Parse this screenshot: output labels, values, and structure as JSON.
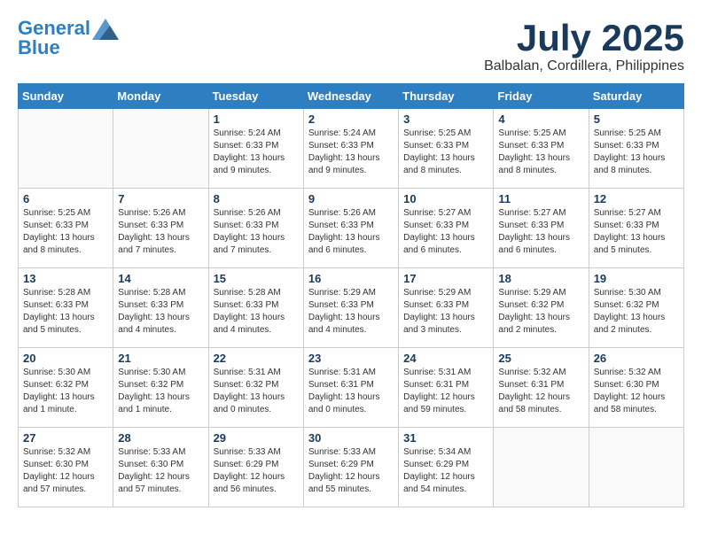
{
  "header": {
    "logo_line1": "General",
    "logo_line2": "Blue",
    "month": "July 2025",
    "location": "Balbalan, Cordillera, Philippines"
  },
  "weekdays": [
    "Sunday",
    "Monday",
    "Tuesday",
    "Wednesday",
    "Thursday",
    "Friday",
    "Saturday"
  ],
  "weeks": [
    [
      {
        "day": "",
        "info": ""
      },
      {
        "day": "",
        "info": ""
      },
      {
        "day": "1",
        "info": "Sunrise: 5:24 AM\nSunset: 6:33 PM\nDaylight: 13 hours\nand 9 minutes."
      },
      {
        "day": "2",
        "info": "Sunrise: 5:24 AM\nSunset: 6:33 PM\nDaylight: 13 hours\nand 9 minutes."
      },
      {
        "day": "3",
        "info": "Sunrise: 5:25 AM\nSunset: 6:33 PM\nDaylight: 13 hours\nand 8 minutes."
      },
      {
        "day": "4",
        "info": "Sunrise: 5:25 AM\nSunset: 6:33 PM\nDaylight: 13 hours\nand 8 minutes."
      },
      {
        "day": "5",
        "info": "Sunrise: 5:25 AM\nSunset: 6:33 PM\nDaylight: 13 hours\nand 8 minutes."
      }
    ],
    [
      {
        "day": "6",
        "info": "Sunrise: 5:25 AM\nSunset: 6:33 PM\nDaylight: 13 hours\nand 8 minutes."
      },
      {
        "day": "7",
        "info": "Sunrise: 5:26 AM\nSunset: 6:33 PM\nDaylight: 13 hours\nand 7 minutes."
      },
      {
        "day": "8",
        "info": "Sunrise: 5:26 AM\nSunset: 6:33 PM\nDaylight: 13 hours\nand 7 minutes."
      },
      {
        "day": "9",
        "info": "Sunrise: 5:26 AM\nSunset: 6:33 PM\nDaylight: 13 hours\nand 6 minutes."
      },
      {
        "day": "10",
        "info": "Sunrise: 5:27 AM\nSunset: 6:33 PM\nDaylight: 13 hours\nand 6 minutes."
      },
      {
        "day": "11",
        "info": "Sunrise: 5:27 AM\nSunset: 6:33 PM\nDaylight: 13 hours\nand 6 minutes."
      },
      {
        "day": "12",
        "info": "Sunrise: 5:27 AM\nSunset: 6:33 PM\nDaylight: 13 hours\nand 5 minutes."
      }
    ],
    [
      {
        "day": "13",
        "info": "Sunrise: 5:28 AM\nSunset: 6:33 PM\nDaylight: 13 hours\nand 5 minutes."
      },
      {
        "day": "14",
        "info": "Sunrise: 5:28 AM\nSunset: 6:33 PM\nDaylight: 13 hours\nand 4 minutes."
      },
      {
        "day": "15",
        "info": "Sunrise: 5:28 AM\nSunset: 6:33 PM\nDaylight: 13 hours\nand 4 minutes."
      },
      {
        "day": "16",
        "info": "Sunrise: 5:29 AM\nSunset: 6:33 PM\nDaylight: 13 hours\nand 4 minutes."
      },
      {
        "day": "17",
        "info": "Sunrise: 5:29 AM\nSunset: 6:33 PM\nDaylight: 13 hours\nand 3 minutes."
      },
      {
        "day": "18",
        "info": "Sunrise: 5:29 AM\nSunset: 6:32 PM\nDaylight: 13 hours\nand 2 minutes."
      },
      {
        "day": "19",
        "info": "Sunrise: 5:30 AM\nSunset: 6:32 PM\nDaylight: 13 hours\nand 2 minutes."
      }
    ],
    [
      {
        "day": "20",
        "info": "Sunrise: 5:30 AM\nSunset: 6:32 PM\nDaylight: 13 hours\nand 1 minute."
      },
      {
        "day": "21",
        "info": "Sunrise: 5:30 AM\nSunset: 6:32 PM\nDaylight: 13 hours\nand 1 minute."
      },
      {
        "day": "22",
        "info": "Sunrise: 5:31 AM\nSunset: 6:32 PM\nDaylight: 13 hours\nand 0 minutes."
      },
      {
        "day": "23",
        "info": "Sunrise: 5:31 AM\nSunset: 6:31 PM\nDaylight: 13 hours\nand 0 minutes."
      },
      {
        "day": "24",
        "info": "Sunrise: 5:31 AM\nSunset: 6:31 PM\nDaylight: 12 hours\nand 59 minutes."
      },
      {
        "day": "25",
        "info": "Sunrise: 5:32 AM\nSunset: 6:31 PM\nDaylight: 12 hours\nand 58 minutes."
      },
      {
        "day": "26",
        "info": "Sunrise: 5:32 AM\nSunset: 6:30 PM\nDaylight: 12 hours\nand 58 minutes."
      }
    ],
    [
      {
        "day": "27",
        "info": "Sunrise: 5:32 AM\nSunset: 6:30 PM\nDaylight: 12 hours\nand 57 minutes."
      },
      {
        "day": "28",
        "info": "Sunrise: 5:33 AM\nSunset: 6:30 PM\nDaylight: 12 hours\nand 57 minutes."
      },
      {
        "day": "29",
        "info": "Sunrise: 5:33 AM\nSunset: 6:29 PM\nDaylight: 12 hours\nand 56 minutes."
      },
      {
        "day": "30",
        "info": "Sunrise: 5:33 AM\nSunset: 6:29 PM\nDaylight: 12 hours\nand 55 minutes."
      },
      {
        "day": "31",
        "info": "Sunrise: 5:34 AM\nSunset: 6:29 PM\nDaylight: 12 hours\nand 54 minutes."
      },
      {
        "day": "",
        "info": ""
      },
      {
        "day": "",
        "info": ""
      }
    ]
  ]
}
